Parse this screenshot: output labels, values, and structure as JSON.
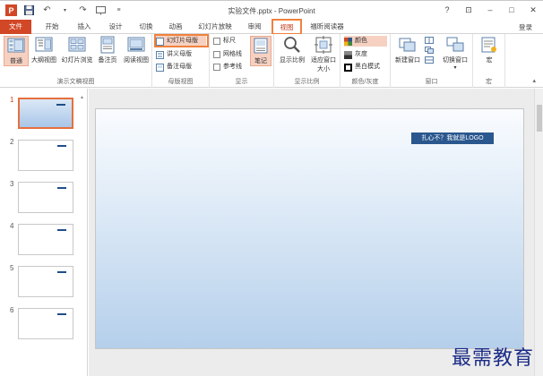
{
  "window": {
    "title": "实验文件.pptx - PowerPoint",
    "login": "登录",
    "controls": [
      "?",
      "⊡",
      "–",
      "□",
      "✕"
    ]
  },
  "tabs": [
    {
      "label": "文件",
      "kind": "file"
    },
    {
      "label": "开始"
    },
    {
      "label": "插入"
    },
    {
      "label": "设计"
    },
    {
      "label": "切换"
    },
    {
      "label": "动画"
    },
    {
      "label": "幻灯片放映"
    },
    {
      "label": "审阅"
    },
    {
      "label": "视图",
      "kind": "active"
    },
    {
      "label": "福昕阅读器"
    }
  ],
  "ribbon": {
    "presentation_views": {
      "label": "演示文稿视图",
      "normal": "普通",
      "outline": "大纲视图",
      "sorter": "幻灯片浏览",
      "notes_page": "备注页",
      "reading": "阅读视图"
    },
    "master_views": {
      "label": "母版视图",
      "slide_master": "幻灯片母版",
      "handout_master": "讲义母版",
      "notes_master": "备注母版"
    },
    "show": {
      "label": "显示",
      "ruler": "标尺",
      "gridlines": "网格线",
      "guides": "参考线",
      "notes": "笔记"
    },
    "zoom": {
      "label": "显示比例",
      "zoom": "显示比例",
      "fit_window": "适应窗口大小"
    },
    "color": {
      "label": "颜色/灰度",
      "color": "颜色",
      "grayscale": "灰度",
      "bw": "黑白模式"
    },
    "window": {
      "label": "窗口",
      "new_window": "新建窗口",
      "switch_window": "切换窗口"
    },
    "macros": {
      "label": "宏",
      "macros": "宏"
    }
  },
  "thumbnails": [
    "1",
    "2",
    "3",
    "4",
    "5",
    "6"
  ],
  "slide": {
    "logo_text": "扎心不？我就是LOGO"
  },
  "watermark": "最需教育"
}
